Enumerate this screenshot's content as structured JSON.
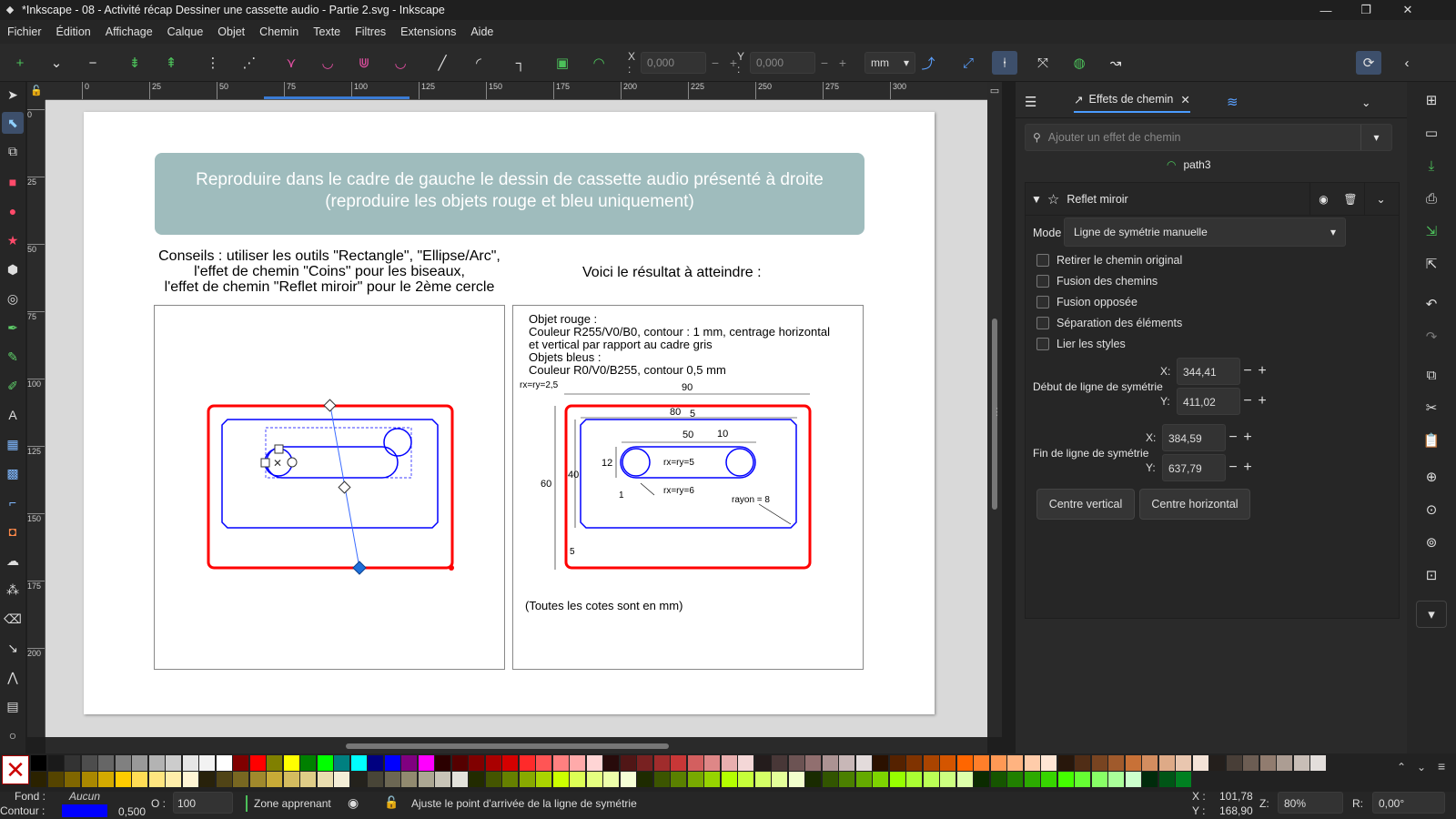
{
  "window": {
    "title": "*Inkscape - 08 - Activité récap Dessiner une cassette audio - Partie 2.svg - Inkscape"
  },
  "menu": [
    "Fichier",
    "Édition",
    "Affichage",
    "Calque",
    "Objet",
    "Chemin",
    "Texte",
    "Filtres",
    "Extensions",
    "Aide"
  ],
  "toolbar": {
    "x_label": "X :",
    "x_value": "0,000",
    "y_label": "Y :",
    "y_value": "0,000",
    "unit": "mm"
  },
  "ruler": {
    "top_ticks": [
      "0",
      "25",
      "50",
      "75",
      "100",
      "125",
      "150",
      "175",
      "200",
      "225",
      "250",
      "275",
      "300"
    ],
    "left_ticks": [
      "0",
      "25",
      "50",
      "75",
      "100",
      "125",
      "150",
      "175",
      "200"
    ]
  },
  "doc": {
    "banner_line1": "Reproduire dans le cadre de gauche le dessin de cassette audio présenté à droite",
    "banner_line2": "(reproduire les objets rouge et bleu uniquement)",
    "tips_line1": "Conseils : utiliser les outils \"Rectangle\", \"Ellipse/Arc\",",
    "tips_line2": "l'effet de chemin \"Coins\" pour les biseaux,",
    "tips_line3": "l'effet de chemin \"Reflet miroir\" pour le 2ème cercle",
    "result_heading": "Voici le résultat à atteindre :",
    "spec_line1": "Objet rouge :",
    "spec_line2": "Couleur R255/V0/B0, contour : 1 mm, centrage horizontal",
    "spec_line3": "et vertical par rapport au cadre gris",
    "spec_line4": "Objets bleus :",
    "spec_line5": "Couleur R0/V0/B255, contour 0,5 mm",
    "dims": {
      "rxry25": "rx=ry=2,5",
      "d90": "90",
      "d80": "80",
      "d5a": "5",
      "d50": "50",
      "d10": "10",
      "d12": "12",
      "rxry5": "rx=ry=5",
      "d60": "60",
      "d40": "40",
      "d1": "1",
      "rxry6": "rx=ry=6",
      "rayon": "rayon = 8",
      "d5b": "5"
    },
    "footnote": "(Toutes les cotes sont en mm)"
  },
  "panel": {
    "tab_title": "Effets de chemin",
    "search_placeholder": "Ajouter un effet de chemin",
    "path_name": "path3",
    "effect_name": "Reflet miroir",
    "mode_label": "Mode",
    "mode_value": "Ligne de symétrie manuelle",
    "checkboxes": [
      "Retirer le chemin original",
      "Fusion des chemins",
      "Fusion opposée",
      "Séparation des éléments",
      "Lier les styles"
    ],
    "start_label": "Début de ligne de symétrie",
    "start_x": "344,41",
    "start_y": "411,02",
    "end_label": "Fin de ligne de symétrie",
    "end_x": "384,59",
    "end_y": "637,79",
    "x_label": "X:",
    "y_label": "Y:",
    "btn_vertical": "Centre vertical",
    "btn_horizontal": "Centre horizontal"
  },
  "status": {
    "fill_label": "Fond :",
    "fill_value": "Aucun",
    "stroke_label": "Contour :",
    "stroke_width": "0,500",
    "opacity_label": "O :",
    "opacity_value": "100",
    "layer": "Zone apprenant",
    "message": "Ajuste le point d'arrivée de la ligne de symétrie",
    "cursor_x_label": "X :",
    "cursor_x": "101,78",
    "cursor_y_label": "Y :",
    "cursor_y": "168,90",
    "zoom_label": "Z:",
    "zoom": "80%",
    "rotate_label": "R:",
    "rotate": "0,00°"
  },
  "colors": {
    "accent": "#3d4f6b",
    "red": "#ff0000",
    "blue": "#0000ff",
    "banner": "#9fbcbd"
  }
}
